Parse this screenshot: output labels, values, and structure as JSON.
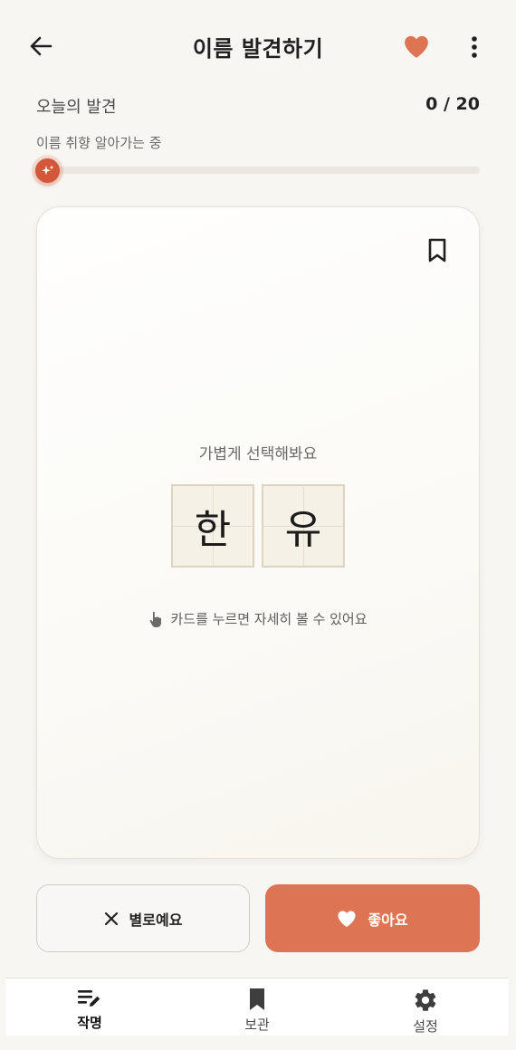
{
  "header": {
    "title": "이름 발견하기",
    "back_icon": "arrow-left-icon",
    "favorite_icon": "heart-icon",
    "more_icon": "more-vertical-icon"
  },
  "progress": {
    "label": "오늘의 발견",
    "count": "0 / 20",
    "sub": "이름 취향 알아가는 중",
    "current": 0,
    "total": 20,
    "knob_icon": "sparkle-icon"
  },
  "card": {
    "hint_top": "가볍게 선택해봐요",
    "syllables": [
      "한",
      "유"
    ],
    "hint_bottom": "카드를 누르면 자세히 볼 수 있어요",
    "bookmark_icon": "bookmark-outline-icon",
    "tap_icon": "tap-finger-icon"
  },
  "actions": {
    "dislike_label": "별로예요",
    "like_label": "좋아요"
  },
  "nav": {
    "items": [
      {
        "label": "작명",
        "icon": "edit-list-icon",
        "active": true
      },
      {
        "label": "보관",
        "icon": "bookmark-icon",
        "active": false
      },
      {
        "label": "설정",
        "icon": "gear-icon",
        "active": false
      }
    ]
  },
  "colors": {
    "accent": "#dd7453",
    "knob": "#d3573a",
    "background": "#f8f6f3"
  }
}
